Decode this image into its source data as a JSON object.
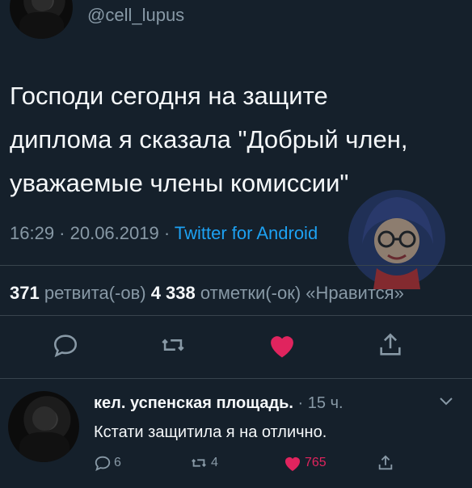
{
  "original_tweet": {
    "handle": "@cell_lupus",
    "text": "Господи сегодня на защите\nдиплома я сказала \"Добрый член,\nуважаемые члены комиссии\"",
    "time": "16:29 · 20.06.2019 · ",
    "source": "Twitter for Android",
    "retweets_count": "371",
    "retweets_label": " ретвита(-ов)  ",
    "likes_count": "4 338",
    "likes_label": " отметки(-ок) «Нравится»",
    "liked": true
  },
  "reply": {
    "name": "кел. успенская площадь.",
    "time": " · 15 ч.",
    "text": "Кстати защитила я на отлично.",
    "reply_count": "6",
    "retweet_count": "4",
    "like_count": "765",
    "liked": true
  },
  "colors": {
    "background": "#15202b",
    "accent": "#1da1f2",
    "like": "#e0245e",
    "secondary_text": "#8899a6"
  },
  "icons": [
    "reply-icon",
    "retweet-icon",
    "heart-icon",
    "share-icon",
    "chevron-down-icon"
  ]
}
